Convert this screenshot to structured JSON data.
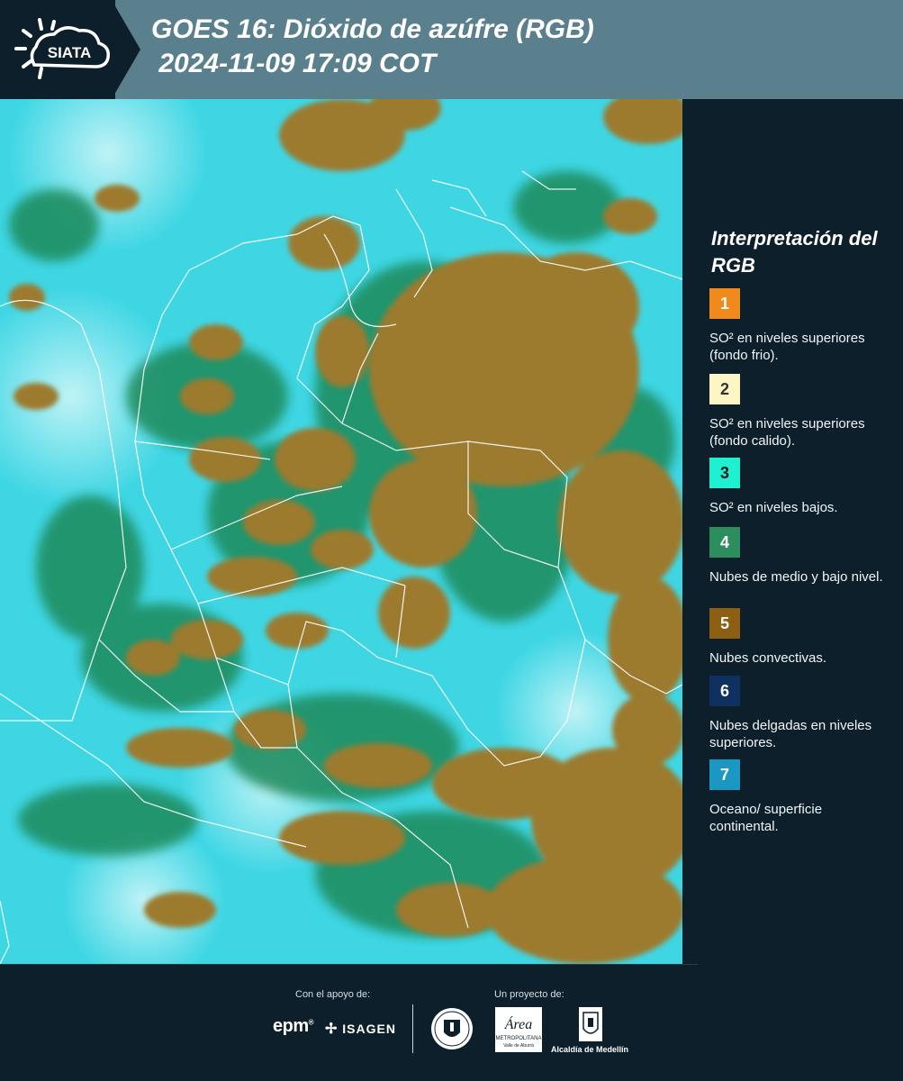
{
  "header": {
    "logo_text": "SIATA",
    "title_line1": "GOES 16: Dióxido de azúfre (RGB)",
    "title_line2": " 2024-11-09 17:09 COT"
  },
  "map": {
    "ocean_color": "#3fd6e4",
    "convective_color": "#9c7a2e",
    "mid_low_cloud_color": "#1f8a5a",
    "border_color": "#ffffff"
  },
  "legend": {
    "title": "Interpretación del RGB",
    "items": [
      {
        "number": "1",
        "color": "#f08a1c",
        "text_color": "#ffffff",
        "label": "SO² en niveles superiores (fondo frio)."
      },
      {
        "number": "2",
        "color": "#fdf6c4",
        "text_color": "#333333",
        "label": "SO² en niveles superiores (fondo calido)."
      },
      {
        "number": "3",
        "color": "#1ff0cf",
        "text_color": "#1a1a1a",
        "label": "SO² en niveles bajos."
      },
      {
        "number": "4",
        "color": "#2e8d5e",
        "text_color": "#ffffff",
        "label": "Nubes de medio y bajo nivel."
      },
      {
        "number": "5",
        "color": "#8c5f12",
        "text_color": "#ffffff",
        "label": "Nubes convectivas."
      },
      {
        "number": "6",
        "color": "#0f3161",
        "text_color": "#ffffff",
        "label": "Nubes delgadas en niveles superiores."
      },
      {
        "number": "7",
        "color": "#1a97c2",
        "text_color": "#ffffff",
        "label": "Oceano/ superficie continental."
      }
    ]
  },
  "footer": {
    "support_label": "Con el apoyo de:",
    "project_label": "Un proyecto de:",
    "epm_text": "epm",
    "isagen_text": "ISAGEN",
    "area_text": "Área",
    "metropolitana_text": "METROPOLITANA",
    "valle_text": "Valle de Aburrá",
    "alcaldia_text": "Alcaldía de Medellín"
  }
}
